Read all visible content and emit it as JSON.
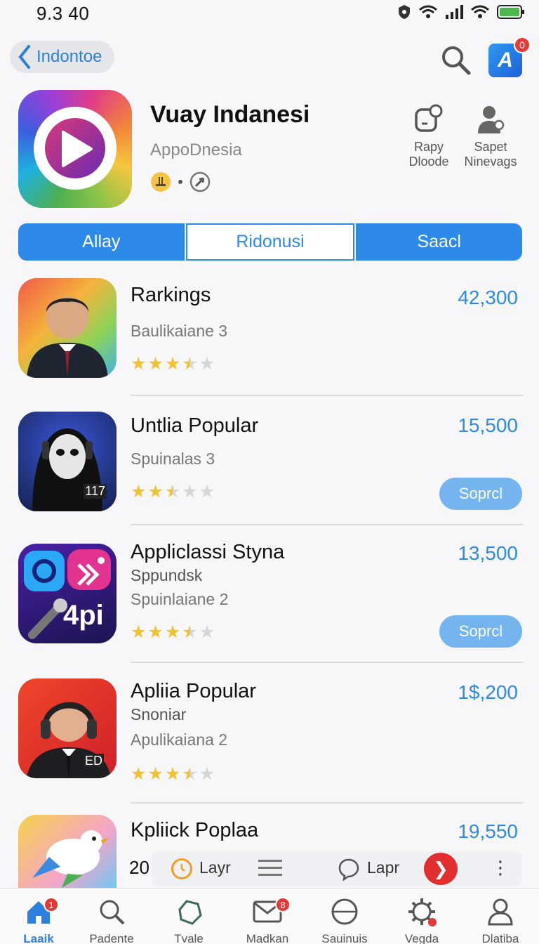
{
  "status_bar": {
    "time": "9.3 40"
  },
  "nav": {
    "back_label": "Indontoe",
    "store_badge": "0"
  },
  "hero": {
    "title": "Vuay Indanesi",
    "developer": "AppoDnesia",
    "actions": [
      {
        "icon": "share-icon",
        "label": "Rapy\nDloode"
      },
      {
        "icon": "person-icon",
        "label": "Sapet\nNinevags"
      }
    ]
  },
  "segments": [
    "Allay",
    "Ridonusi",
    "Saacl"
  ],
  "apps": [
    {
      "name": "Rarkings",
      "sub": "",
      "rank": "Baulikaiane 3",
      "count": "42,300",
      "rating": 3.5,
      "button": ""
    },
    {
      "name": "Untlia Popular",
      "sub": "",
      "rank": "Spuinalas 3",
      "count": "15,500",
      "rating": 2.5,
      "button": "Soprcl"
    },
    {
      "name": "Appliclassi Styna",
      "sub": "Sppundsk",
      "rank": "Spuinlaiane 2",
      "count": "13,500",
      "rating": 3.5,
      "button": "Soprcl"
    },
    {
      "name": "Apliia Popular",
      "sub": "Snoniar",
      "rank": "Apulikaiana 2",
      "count": "1$,200",
      "rating": 3.5,
      "button": ""
    },
    {
      "name": "Kpliick Poplaa",
      "sub": "",
      "rank": "20",
      "count": "19,550",
      "rating": 0,
      "button": ""
    }
  ],
  "app_icon_text": {
    "dark": "117",
    "purple": "4pi",
    "red": "ED"
  },
  "mini_player": {
    "label_left": "Layr",
    "label_right": "Lapr"
  },
  "tabs": [
    {
      "label": "Laaik",
      "icon": "home-icon",
      "badge": "1",
      "active": true
    },
    {
      "label": "Padente",
      "icon": "search-icon",
      "badge": "",
      "active": false
    },
    {
      "label": "Tvale",
      "icon": "shape-icon",
      "badge": "",
      "active": false
    },
    {
      "label": "Madkan",
      "icon": "mail-icon",
      "badge": "8",
      "active": false
    },
    {
      "label": "Sauinuis",
      "icon": "globe-icon",
      "badge": "",
      "active": false
    },
    {
      "label": "Vegda",
      "icon": "gear-icon",
      "badge": "",
      "active": false
    },
    {
      "label": "Dlatiba",
      "icon": "profile-icon",
      "badge": "",
      "active": false
    }
  ],
  "colors": {
    "accent": "#2d8ae8",
    "button_light": "#74b5f0",
    "star": "#f2c12e",
    "badge": "#e53935"
  }
}
